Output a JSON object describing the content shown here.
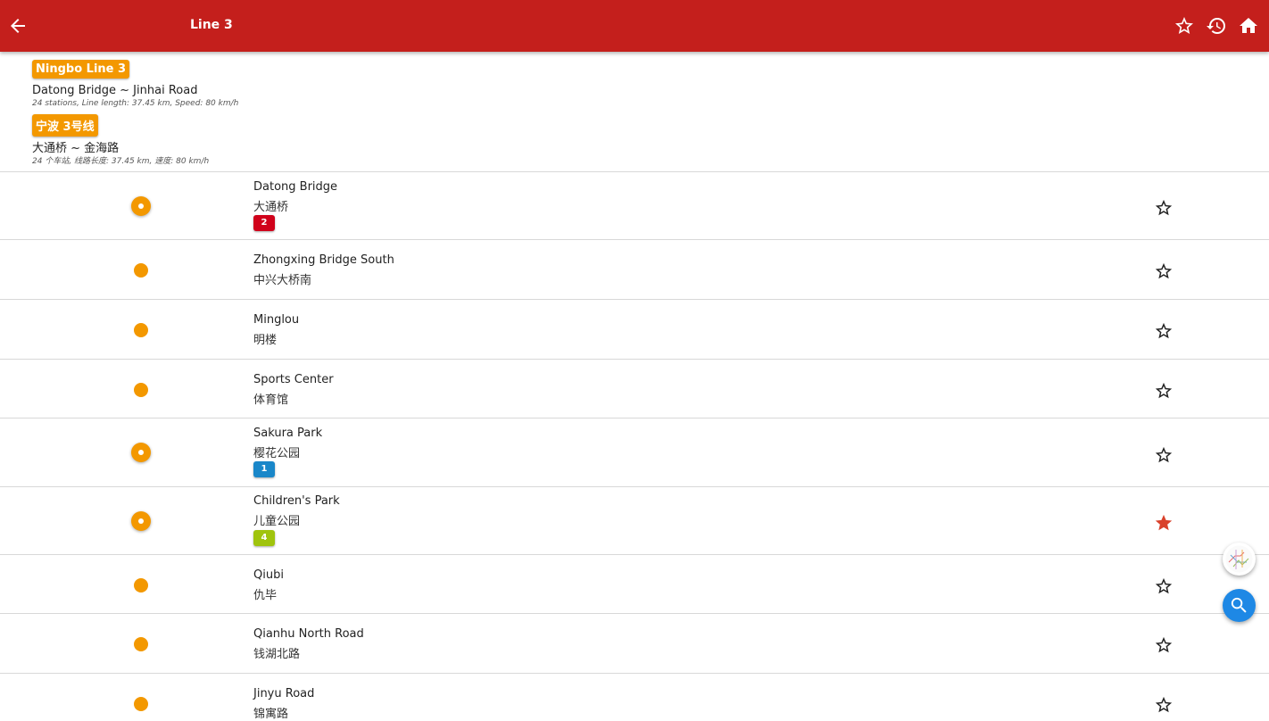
{
  "appbar": {
    "title": "Line 3"
  },
  "header": {
    "en_badge": "Ningbo Line 3",
    "en_route": "Datong Bridge ~ Jinhai Road",
    "en_meta": "24 stations, Line length: 37.45 km, Speed: 80 km/h",
    "zh_badge": "宁波 3号线",
    "zh_route": "大通桥 ~ 金海路",
    "zh_meta": "24 个车站, 线路长度: 37.45 km, 速度: 80 km/h"
  },
  "colors": {
    "appbar": "#c41f1c",
    "line": "#f39800",
    "favorite": "#d9412b",
    "search_fab": "#1e88e5"
  },
  "stations": [
    {
      "name": "Datong Bridge",
      "name_zh": "大通桥",
      "transfer": "2",
      "transfer_color": "#d0021b",
      "favorite": false
    },
    {
      "name": "Zhongxing Bridge South",
      "name_zh": "中兴大桥南",
      "favorite": false
    },
    {
      "name": "Minglou",
      "name_zh": "明楼",
      "favorite": false
    },
    {
      "name": "Sports Center",
      "name_zh": "体育馆",
      "favorite": false
    },
    {
      "name": "Sakura Park",
      "name_zh": "樱花公园",
      "transfer": "1",
      "transfer_color": "#1a87c9",
      "favorite": false
    },
    {
      "name": "Children's Park",
      "name_zh": "儿童公园",
      "transfer": "4",
      "transfer_color": "#a0c40d",
      "favorite": true
    },
    {
      "name": "Qiubi",
      "name_zh": "仇毕",
      "favorite": false
    },
    {
      "name": "Qianhu North Road",
      "name_zh": "钱湖北路",
      "favorite": false
    },
    {
      "name": "Jinyu Road",
      "name_zh": "锦寓路",
      "favorite": false
    }
  ]
}
